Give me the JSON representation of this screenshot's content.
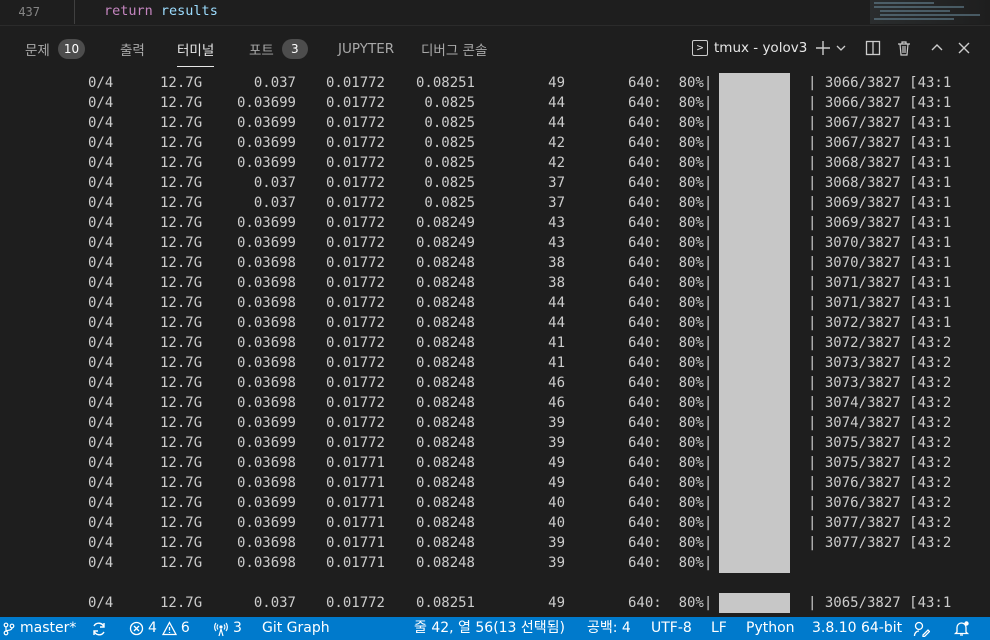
{
  "editor": {
    "line_number": "437",
    "code_keyword": "return",
    "code_identifier": "results"
  },
  "panel": {
    "tabs": [
      {
        "label": "문제",
        "badge": "10"
      },
      {
        "label": "출력"
      },
      {
        "label": "터미널",
        "active": true
      },
      {
        "label": "포트",
        "badge": "3"
      },
      {
        "label": "JUPYTER"
      },
      {
        "label": "디버그 콘솔"
      }
    ],
    "terminal_name": "tmux - yolov3",
    "icons": [
      "terminal-icon",
      "plus-icon",
      "chevron-down-icon",
      "split-icon",
      "trash-icon",
      "chevron-up-icon",
      "close-icon"
    ]
  },
  "terminal": {
    "rows": [
      {
        "ep": "0/4",
        "mem": "12.7G",
        "box": "0.037",
        "obj": "0.01772",
        "cls": "0.08251",
        "tgt": "49",
        "size": "640:  80%|",
        "tail": "| 3066/3827 [43:1"
      },
      {
        "ep": "0/4",
        "mem": "12.7G",
        "box": "0.03699",
        "obj": "0.01772",
        "cls": "0.0825",
        "tgt": "44",
        "size": "640:  80%|",
        "tail": "| 3066/3827 [43:1"
      },
      {
        "ep": "0/4",
        "mem": "12.7G",
        "box": "0.03699",
        "obj": "0.01772",
        "cls": "0.0825",
        "tgt": "44",
        "size": "640:  80%|",
        "tail": "| 3067/3827 [43:1"
      },
      {
        "ep": "0/4",
        "mem": "12.7G",
        "box": "0.03699",
        "obj": "0.01772",
        "cls": "0.0825",
        "tgt": "42",
        "size": "640:  80%|",
        "tail": "| 3067/3827 [43:1"
      },
      {
        "ep": "0/4",
        "mem": "12.7G",
        "box": "0.03699",
        "obj": "0.01772",
        "cls": "0.0825",
        "tgt": "42",
        "size": "640:  80%|",
        "tail": "| 3068/3827 [43:1"
      },
      {
        "ep": "0/4",
        "mem": "12.7G",
        "box": "0.037",
        "obj": "0.01772",
        "cls": "0.0825",
        "tgt": "37",
        "size": "640:  80%|",
        "tail": "| 3068/3827 [43:1"
      },
      {
        "ep": "0/4",
        "mem": "12.7G",
        "box": "0.037",
        "obj": "0.01772",
        "cls": "0.0825",
        "tgt": "37",
        "size": "640:  80%|",
        "tail": "| 3069/3827 [43:1"
      },
      {
        "ep": "0/4",
        "mem": "12.7G",
        "box": "0.03699",
        "obj": "0.01772",
        "cls": "0.08249",
        "tgt": "43",
        "size": "640:  80%|",
        "tail": "| 3069/3827 [43:1"
      },
      {
        "ep": "0/4",
        "mem": "12.7G",
        "box": "0.03699",
        "obj": "0.01772",
        "cls": "0.08249",
        "tgt": "43",
        "size": "640:  80%|",
        "tail": "| 3070/3827 [43:1"
      },
      {
        "ep": "0/4",
        "mem": "12.7G",
        "box": "0.03698",
        "obj": "0.01772",
        "cls": "0.08248",
        "tgt": "38",
        "size": "640:  80%|",
        "tail": "| 3070/3827 [43:1"
      },
      {
        "ep": "0/4",
        "mem": "12.7G",
        "box": "0.03698",
        "obj": "0.01772",
        "cls": "0.08248",
        "tgt": "38",
        "size": "640:  80%|",
        "tail": "| 3071/3827 [43:1"
      },
      {
        "ep": "0/4",
        "mem": "12.7G",
        "box": "0.03698",
        "obj": "0.01772",
        "cls": "0.08248",
        "tgt": "44",
        "size": "640:  80%|",
        "tail": "| 3071/3827 [43:1"
      },
      {
        "ep": "0/4",
        "mem": "12.7G",
        "box": "0.03698",
        "obj": "0.01772",
        "cls": "0.08248",
        "tgt": "44",
        "size": "640:  80%|",
        "tail": "| 3072/3827 [43:1"
      },
      {
        "ep": "0/4",
        "mem": "12.7G",
        "box": "0.03698",
        "obj": "0.01772",
        "cls": "0.08248",
        "tgt": "41",
        "size": "640:  80%|",
        "tail": "| 3072/3827 [43:2"
      },
      {
        "ep": "0/4",
        "mem": "12.7G",
        "box": "0.03698",
        "obj": "0.01772",
        "cls": "0.08248",
        "tgt": "41",
        "size": "640:  80%|",
        "tail": "| 3073/3827 [43:2"
      },
      {
        "ep": "0/4",
        "mem": "12.7G",
        "box": "0.03698",
        "obj": "0.01772",
        "cls": "0.08248",
        "tgt": "46",
        "size": "640:  80%|",
        "tail": "| 3073/3827 [43:2"
      },
      {
        "ep": "0/4",
        "mem": "12.7G",
        "box": "0.03698",
        "obj": "0.01772",
        "cls": "0.08248",
        "tgt": "46",
        "size": "640:  80%|",
        "tail": "| 3074/3827 [43:2"
      },
      {
        "ep": "0/4",
        "mem": "12.7G",
        "box": "0.03699",
        "obj": "0.01772",
        "cls": "0.08248",
        "tgt": "39",
        "size": "640:  80%|",
        "tail": "| 3074/3827 [43:2"
      },
      {
        "ep": "0/4",
        "mem": "12.7G",
        "box": "0.03699",
        "obj": "0.01772",
        "cls": "0.08248",
        "tgt": "39",
        "size": "640:  80%|",
        "tail": "| 3075/3827 [43:2"
      },
      {
        "ep": "0/4",
        "mem": "12.7G",
        "box": "0.03698",
        "obj": "0.01771",
        "cls": "0.08248",
        "tgt": "49",
        "size": "640:  80%|",
        "tail": "| 3075/3827 [43:2"
      },
      {
        "ep": "0/4",
        "mem": "12.7G",
        "box": "0.03698",
        "obj": "0.01771",
        "cls": "0.08248",
        "tgt": "49",
        "size": "640:  80%|",
        "tail": "| 3076/3827 [43:2"
      },
      {
        "ep": "0/4",
        "mem": "12.7G",
        "box": "0.03699",
        "obj": "0.01771",
        "cls": "0.08248",
        "tgt": "40",
        "size": "640:  80%|",
        "tail": "| 3076/3827 [43:2"
      },
      {
        "ep": "0/4",
        "mem": "12.7G",
        "box": "0.03699",
        "obj": "0.01771",
        "cls": "0.08248",
        "tgt": "40",
        "size": "640:  80%|",
        "tail": "| 3077/3827 [43:2"
      },
      {
        "ep": "0/4",
        "mem": "12.7G",
        "box": "0.03698",
        "obj": "0.01771",
        "cls": "0.08248",
        "tgt": "39",
        "size": "640:  80%|",
        "tail": "| 3077/3827 [43:2"
      },
      {
        "ep": "0/4",
        "mem": "12.7G",
        "box": "0.03698",
        "obj": "0.01771",
        "cls": "0.08248",
        "tgt": "39",
        "size": "640:  80%|",
        "tail": ""
      },
      null,
      {
        "ep": "0/4",
        "mem": "12.7G",
        "box": "0.037",
        "obj": "0.01772",
        "cls": "0.08251",
        "tgt": "49",
        "size": "640:  80%|",
        "tail": "| 3065/3827 [43:1"
      }
    ]
  },
  "status_bar": {
    "branch": "master*",
    "errors": "4",
    "warnings": "6",
    "ports": "3",
    "git_graph": "Git Graph",
    "cursor": "줄 42, 열 56(13 선택됨)",
    "indent": "공백: 4",
    "encoding": "UTF-8",
    "eol": "LF",
    "language": "Python",
    "interpreter": "3.8.10 64-bit"
  }
}
